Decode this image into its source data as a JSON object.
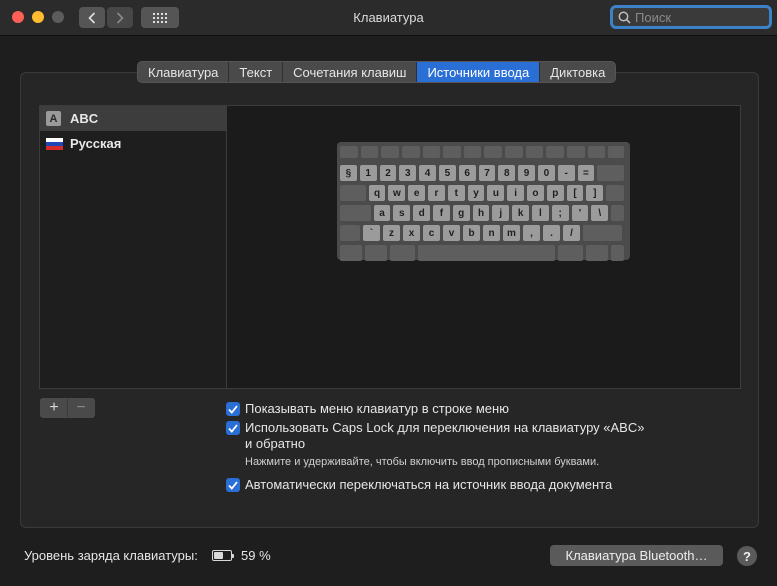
{
  "window": {
    "title": "Клавиатура"
  },
  "search": {
    "placeholder": "Поиск",
    "value": ""
  },
  "tabs": [
    {
      "label": "Клавиатура",
      "active": false
    },
    {
      "label": "Текст",
      "active": false
    },
    {
      "label": "Сочетания клавиш",
      "active": false
    },
    {
      "label": "Источники ввода",
      "active": true
    },
    {
      "label": "Диктовка",
      "active": false
    }
  ],
  "sources": [
    {
      "label": "ABC",
      "icon": "letter-a",
      "badge": "A",
      "selected": true
    },
    {
      "label": "Русская",
      "icon": "russian-flag",
      "selected": false
    }
  ],
  "keyboard": {
    "rows": [
      [
        "§",
        "1",
        "2",
        "3",
        "4",
        "5",
        "6",
        "7",
        "8",
        "9",
        "0",
        "-",
        "="
      ],
      [
        "q",
        "w",
        "e",
        "r",
        "t",
        "y",
        "u",
        "i",
        "o",
        "p",
        "[",
        "]"
      ],
      [
        "a",
        "s",
        "d",
        "f",
        "g",
        "h",
        "j",
        "k",
        "l",
        ";",
        "'",
        "\\"
      ],
      [
        "`",
        "z",
        "x",
        "c",
        "v",
        "b",
        "n",
        "m",
        ",",
        ".",
        "/"
      ]
    ]
  },
  "list_buttons": {
    "add": "+",
    "remove": "−"
  },
  "options": {
    "show_menu": {
      "label": "Показывать меню клавиатур в строке меню",
      "checked": true
    },
    "caps_lock_line1": "Использовать Caps Lock для переключения на клавиатуру «ABC»",
    "caps_lock_line2": "и обратно",
    "caps_lock_checked": true,
    "caps_lock_note": "Нажмите и удерживайте, чтобы включить ввод прописными буквами.",
    "auto_switch": {
      "label": "Автоматически переключаться на источник ввода документа",
      "checked": true
    }
  },
  "footer": {
    "battery_label": "Уровень заряда клавиатуры:",
    "battery_percent": "59 %",
    "battery_level": 0.59,
    "bluetooth_button": "Клавиатура Bluetooth…",
    "help": "?"
  },
  "colors": {
    "accent": "#2a6fd6"
  }
}
